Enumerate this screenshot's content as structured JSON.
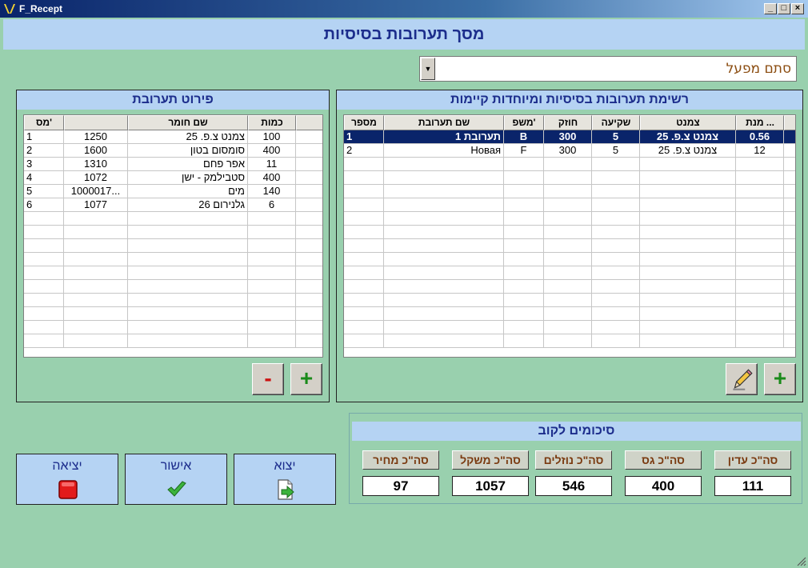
{
  "window": {
    "title": "F_Recept"
  },
  "header": {
    "title": "מסך תערובות בסיסיות"
  },
  "factory": {
    "value": "סתם מפעל"
  },
  "mixtures": {
    "title": "רשימת תערובות בסיסיות ומיוחדות קיימות",
    "columns": [
      "מספר",
      "שם תערובת",
      "משפ'",
      "חוזק",
      "שקיעה",
      "צמנט",
      "מנת ..."
    ],
    "rows": [
      {
        "num": "1",
        "name": "תערובת 1",
        "family": "B",
        "strength": "300",
        "slump": "5",
        "cement": "צמנט צ.פ. 25",
        "dose": "0.56"
      },
      {
        "num": "2",
        "name": "Новая",
        "family": "F",
        "strength": "300",
        "slump": "5",
        "cement": "צמנט צ.פ. 25",
        "dose": "12"
      }
    ]
  },
  "details": {
    "title": "פירוט תערובת",
    "columns": [
      "מס'",
      "",
      "שם חומר",
      "כמות"
    ],
    "rows": [
      {
        "n": "1",
        "code": "1250",
        "material": "צמנט צ.פ. 25",
        "qty": "100"
      },
      {
        "n": "2",
        "code": "1600",
        "material": "סומסום בטון",
        "qty": "400"
      },
      {
        "n": "3",
        "code": "1310",
        "material": "אפר פחם",
        "qty": "11"
      },
      {
        "n": "4",
        "code": "1072",
        "material": "סטבילמק - ישן",
        "qty": "400"
      },
      {
        "n": "5",
        "code": "1000017...",
        "material": "מים",
        "qty": "140"
      },
      {
        "n": "6",
        "code": "1077",
        "material": "גלנירום 26",
        "qty": "6"
      }
    ]
  },
  "buttons": {
    "plus": "+",
    "minus": "-"
  },
  "summary": {
    "title": "סיכומים לקוב",
    "items": [
      {
        "label": "סה\"כ מחיר",
        "value": "97"
      },
      {
        "label": "סה\"כ משקל",
        "value": "1057"
      },
      {
        "label": "סה\"כ נוזלים",
        "value": "546"
      },
      {
        "label": "סה\"כ גס",
        "value": "400"
      },
      {
        "label": "סה\"כ עדין",
        "value": "111"
      }
    ]
  },
  "actions": {
    "exit": "יציאה",
    "confirm": "אישור",
    "export": "יצוא"
  },
  "colors": {
    "header_bg": "#b5d3f3",
    "body_bg": "#99d0ae",
    "selection": "#0a246a"
  }
}
